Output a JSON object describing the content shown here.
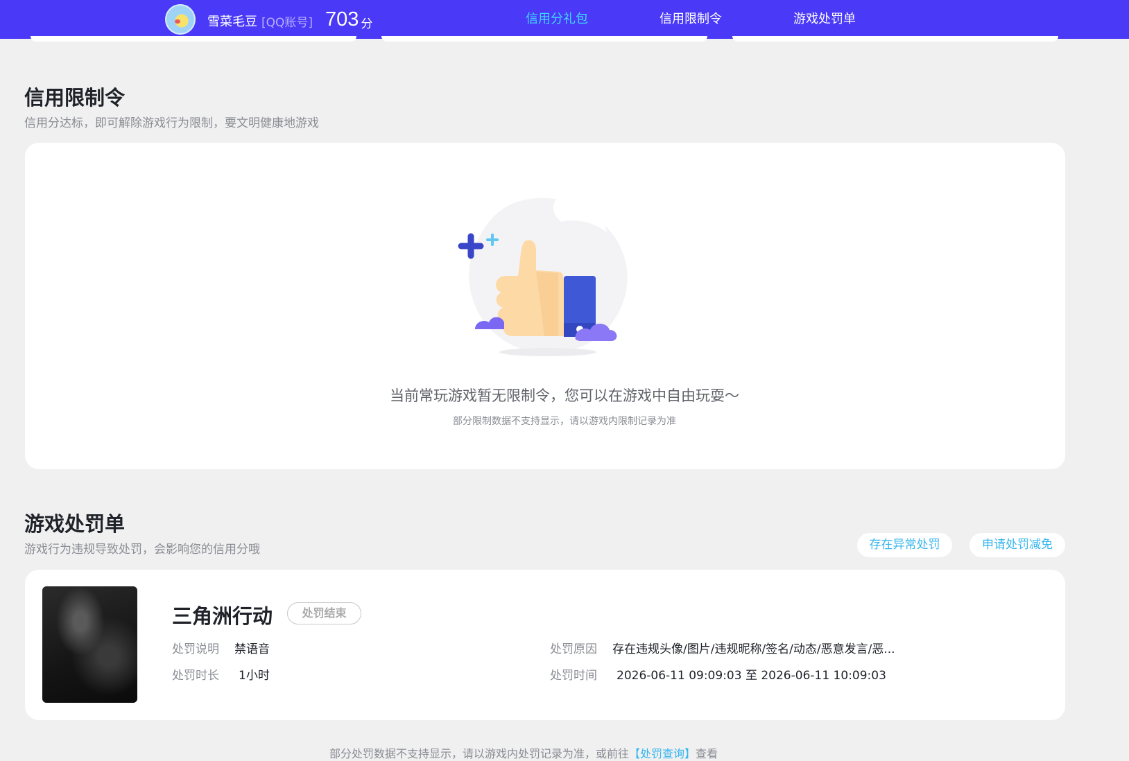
{
  "header": {
    "nickname": "雪菜毛豆",
    "account_type": "[QQ账号]",
    "score": "703",
    "score_unit": "分",
    "nav": [
      {
        "label": "信用分礼包",
        "active": true
      },
      {
        "label": "信用限制令",
        "active": false
      },
      {
        "label": "游戏处罚单",
        "active": false
      }
    ]
  },
  "restriction": {
    "title": "信用限制令",
    "subtitle": "信用分达标，即可解除游戏行为限制，要文明健康地游戏",
    "empty_message": "当前常玩游戏暂无限制令，您可以在游戏中自由玩耍～",
    "empty_note": "部分限制数据不支持显示，请以游戏内限制记录为准"
  },
  "punishment": {
    "title": "游戏处罚单",
    "subtitle": "游戏行为违规导致处罚，会影响您的信用分哦",
    "appeal_button": "存在异常处罚",
    "reduce_button": "申请处罚减免",
    "records": [
      {
        "game": "三角洲行动",
        "status": "处罚结束",
        "desc_label": "处罚说明",
        "desc_value": "禁语音",
        "duration_label": "处罚时长",
        "duration_value": "1小时",
        "reason_label": "处罚原因",
        "reason_value": "存在违规头像/图片/违规昵称/签名/动态/恶意发言/恶...",
        "time_label": "处罚时间",
        "time_value": "2026-06-11 09:09:03 至 2026-06-11 10:09:03"
      }
    ],
    "footer_text": "部分处罚数据不支持显示，请以游戏内处罚记录为准，或前往",
    "footer_link": "【处罚查询】",
    "footer_suffix": "查看"
  },
  "colors": {
    "header_bg": "#4a39f7",
    "accent_cyan": "#40d8ff",
    "link_blue": "#36b6ee",
    "page_bg": "#f0f0f0"
  }
}
